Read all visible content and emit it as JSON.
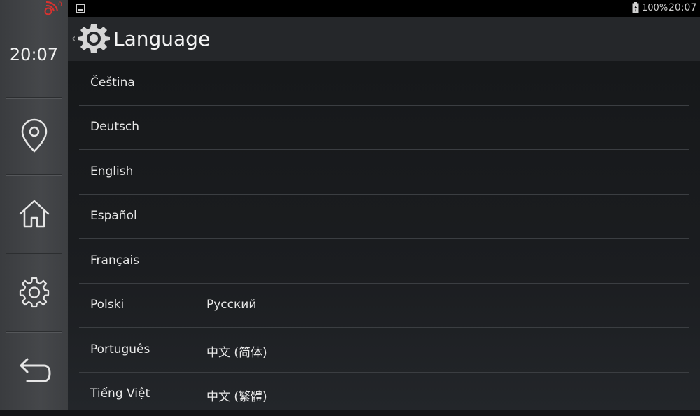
{
  "dock": {
    "clock": "20:07",
    "buttons": [
      "location",
      "home",
      "settings",
      "back"
    ]
  },
  "statusbar": {
    "battery": "100%",
    "time": "20:07"
  },
  "actionbar": {
    "title": "Language"
  },
  "languages": [
    [
      "Čeština",
      ""
    ],
    [
      "Deutsch",
      ""
    ],
    [
      "English",
      ""
    ],
    [
      "Español",
      ""
    ],
    [
      "Français",
      ""
    ],
    [
      "Polski",
      "Русский"
    ],
    [
      "Português",
      "中文 (简体)"
    ],
    [
      "Tiếng Việt",
      "中文 (繁體)"
    ]
  ]
}
